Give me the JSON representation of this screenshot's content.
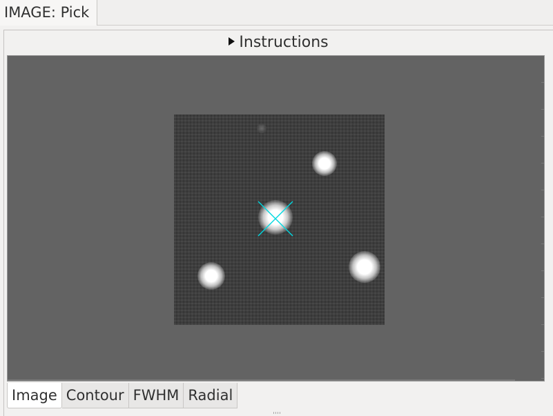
{
  "window": {
    "tab_label": "IMAGE: Pick"
  },
  "instructions": {
    "label": "Instructions",
    "icon": "triangle-right-icon"
  },
  "viewer": {
    "background": "#636363",
    "image_background": "#3a3a3a",
    "marker_color": "#00d8e0",
    "marker_icon": "x-cross-marker"
  },
  "tabs": [
    {
      "label": "Image",
      "active": true
    },
    {
      "label": "Contour",
      "active": false
    },
    {
      "label": "FWHM",
      "active": false
    },
    {
      "label": "Radial",
      "active": false
    }
  ]
}
